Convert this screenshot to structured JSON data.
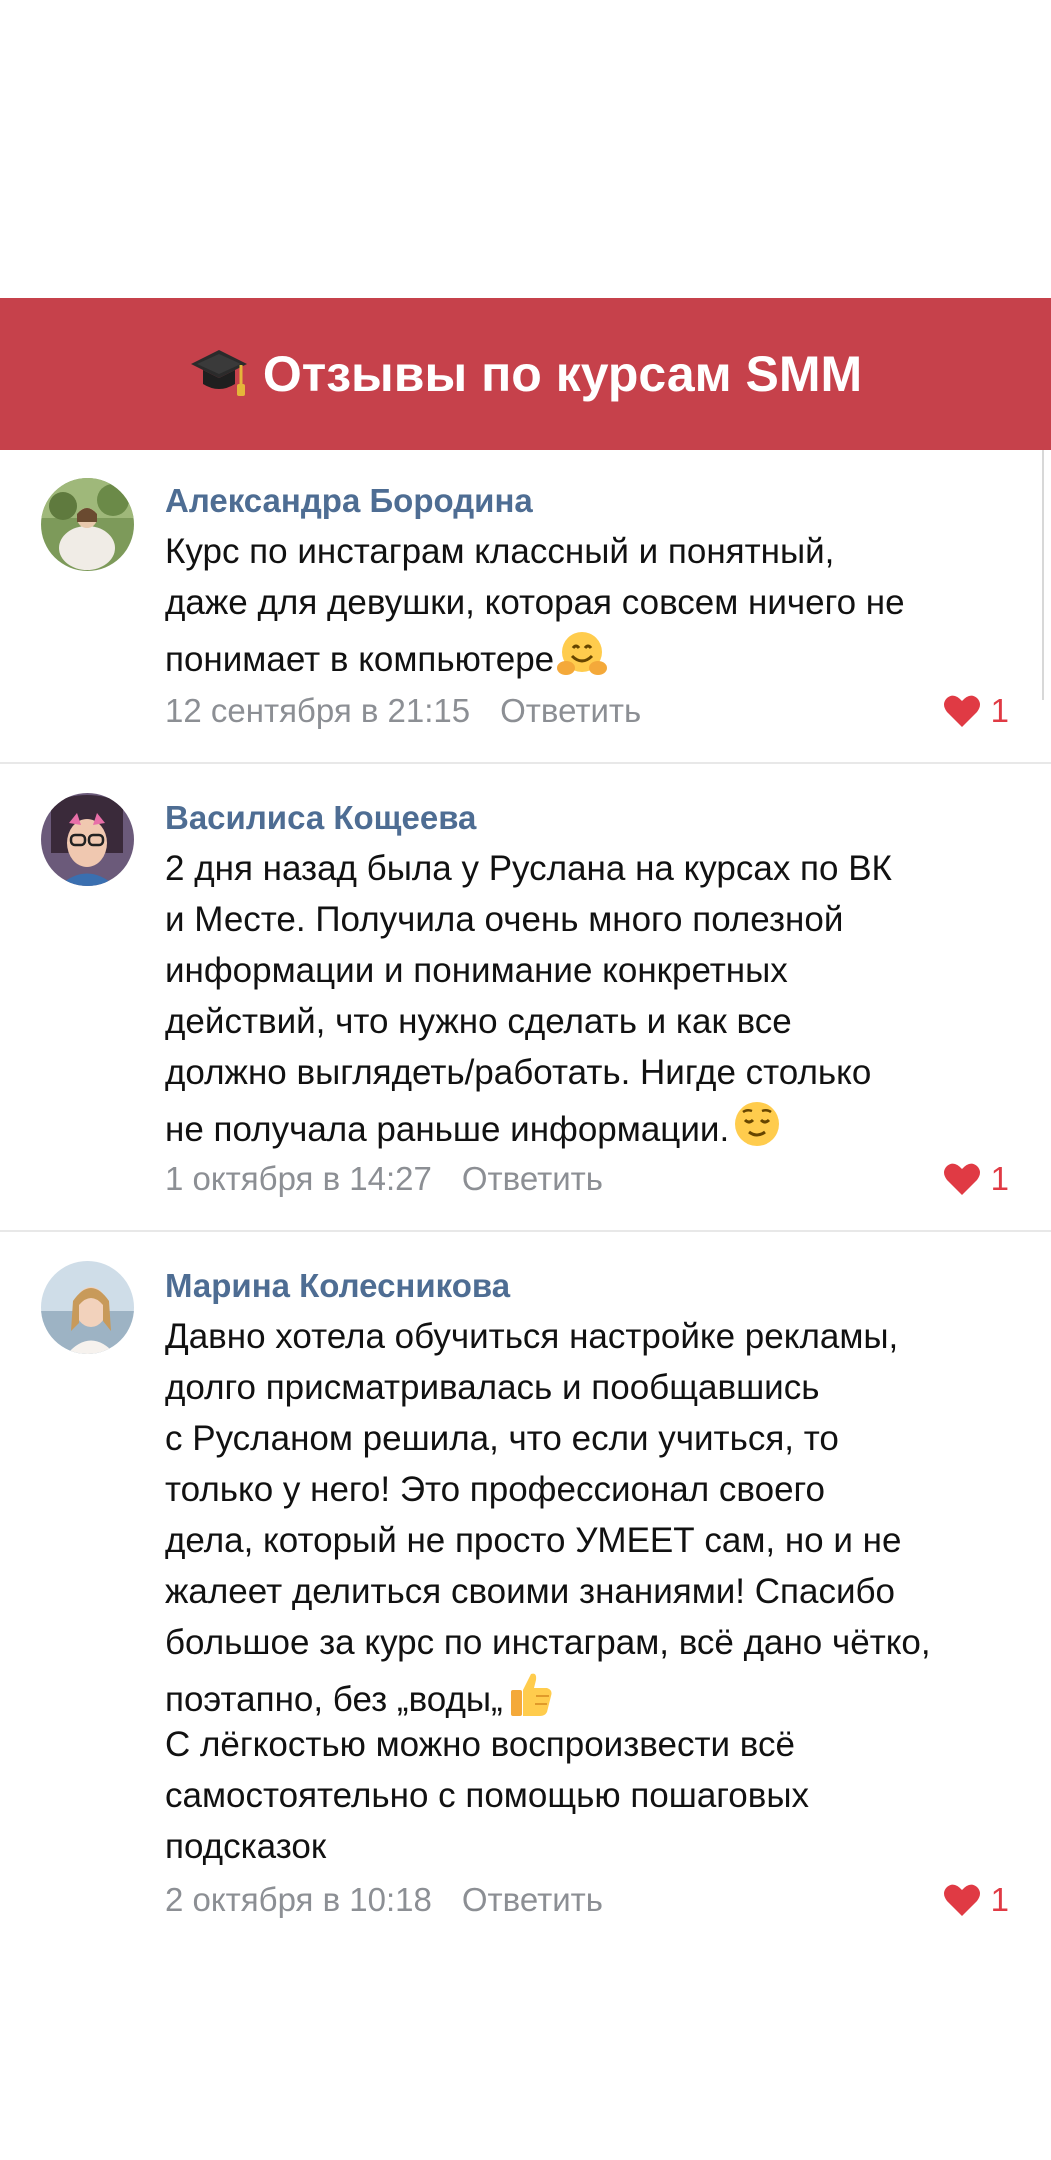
{
  "header": {
    "title": "Отзывы по курсам SMM",
    "icon": "graduation-cap-icon",
    "background": "#c6414b"
  },
  "comments": [
    {
      "author": "Александра Бородина",
      "lines": [
        "Курс по инстаграм классный и понятный,",
        "даже для девушки, которая совсем ничего не",
        "понимает в компьютере"
      ],
      "emoji": "hugging-face-emoji",
      "date": "12 сентября в 21:15",
      "reply": "Ответить",
      "likes": "1"
    },
    {
      "author": "Василиса Кощеева",
      "lines": [
        "2 дня назад была у Руслана на курсах  по ВК",
        "и Месте.  Получила очень много полезной",
        "информации и понимание конкретных",
        "действий,  что нужно сделать и как все",
        "должно выглядеть/работать. Нигде столько",
        "не получала раньше информации."
      ],
      "emoji": "relieved-face-emoji",
      "date": "1 октября в 14:27",
      "reply": "Ответить",
      "likes": "1"
    },
    {
      "author": "Марина Колесникова",
      "lines": [
        "Давно хотела обучиться настройке рекламы,",
        "долго присматривалась и пообщавшись",
        "с Русланом решила, что если учиться, то",
        "только у него! Это профессионал своего",
        "дела, который не просто УМЕЕТ сам, но и не",
        "жалеет делиться своими знаниями! Спасибо",
        "большое за курс по инстаграм, всё дано чётко,",
        "поэтапно, без „воды„",
        "С лёгкостью можно воспроизвести всё",
        "самостоятельно с помощью пошаговых",
        "подсказок"
      ],
      "emoji": "thumbs-up-emoji",
      "date": "2 октября в 10:18",
      "reply": "Ответить",
      "likes": "1"
    }
  ],
  "colors": {
    "author": "#4e6d93",
    "meta": "#8c8f94",
    "like": "#e03a44"
  }
}
